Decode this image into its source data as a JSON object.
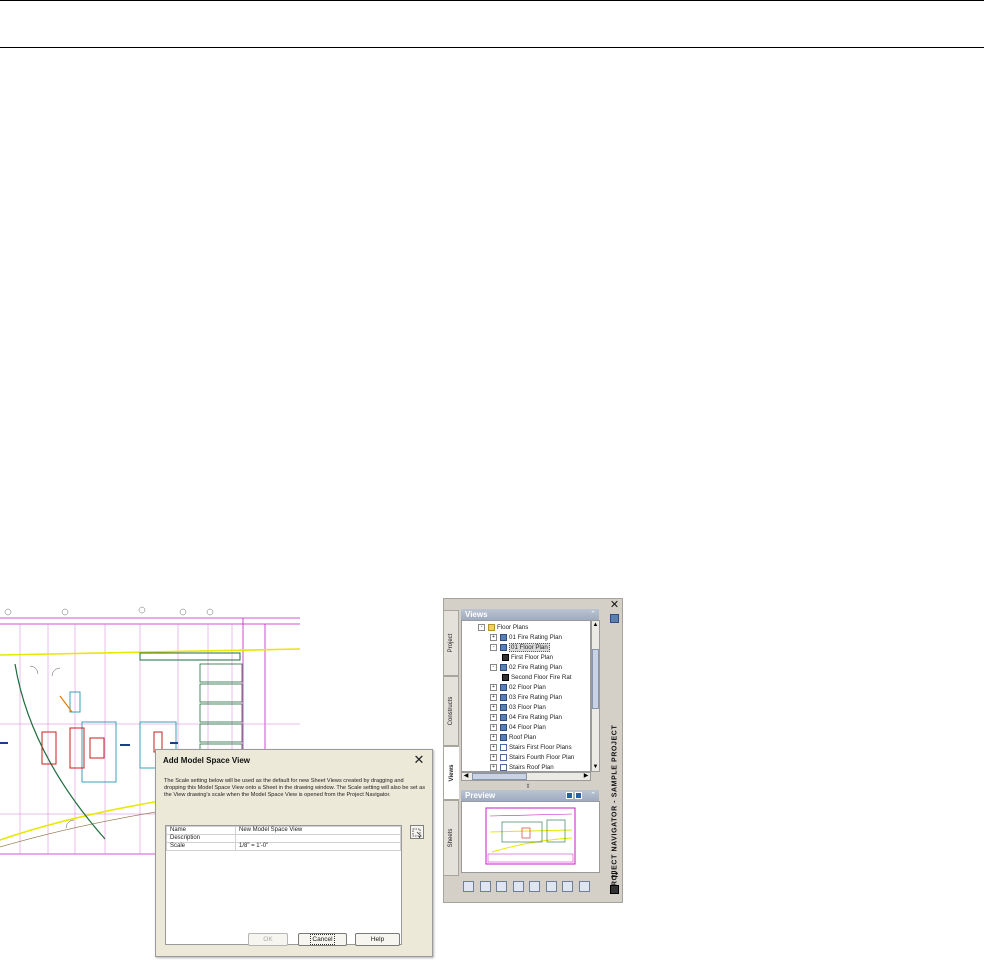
{
  "dialog": {
    "title": "Add Model Space View",
    "description": "The Scale setting below will be used as the default for new Sheet Views created by dragging and dropping this Model Space View onto a Sheet in the drawing window. The Scale setting will also be set as the View drawing's scale when the Model Space View is opened from the Project Navigator.",
    "fields": [
      {
        "label": "Name",
        "value": "New Model Space View"
      },
      {
        "label": "Description",
        "value": ""
      },
      {
        "label": "Scale",
        "value": "1/8\" = 1'-0\""
      }
    ],
    "buttons": {
      "ok": "OK",
      "cancel": "Cancel",
      "help": "Help"
    }
  },
  "navigator": {
    "title": "PROJECT NAVIGATOR - SAMPLE PROJECT",
    "tabs": [
      "Project",
      "Constructs",
      "Views",
      "Sheets"
    ],
    "active_tab": "Views",
    "views_header": "Views",
    "preview_header": "Preview",
    "tree": [
      {
        "label": "Floor Plans",
        "level": 0,
        "icon": "folder-icon",
        "expander": "-"
      },
      {
        "label": "01 Fire Rating Plan",
        "level": 1,
        "icon": "view-icon",
        "expander": "+"
      },
      {
        "label": "01 Floor Plan",
        "level": 1,
        "icon": "view-icon",
        "expander": "-",
        "selected": true
      },
      {
        "label": "First Floor Plan",
        "level": 2,
        "icon": "modelspace-icon",
        "expander": ""
      },
      {
        "label": "02 Fire Rating Plan",
        "level": 1,
        "icon": "view-icon",
        "expander": "-"
      },
      {
        "label": "Second Floor Fire Rat",
        "level": 2,
        "icon": "modelspace-icon",
        "expander": ""
      },
      {
        "label": "02 Floor Plan",
        "level": 1,
        "icon": "view-icon",
        "expander": "+"
      },
      {
        "label": "03 Fire Rating Plan",
        "level": 1,
        "icon": "view-icon",
        "expander": "+"
      },
      {
        "label": "03 Floor Plan",
        "level": 1,
        "icon": "view-icon",
        "expander": "+"
      },
      {
        "label": "04 Fire Rating Plan",
        "level": 1,
        "icon": "view-icon",
        "expander": "+"
      },
      {
        "label": "04 Floor Plan",
        "level": 1,
        "icon": "view-icon",
        "expander": "+"
      },
      {
        "label": "Roof Plan",
        "level": 1,
        "icon": "view-icon",
        "expander": "+"
      },
      {
        "label": "Stairs First Floor Plans",
        "level": 1,
        "icon": "stair-view-icon",
        "expander": "+"
      },
      {
        "label": "Stairs Fourth Floor Plan",
        "level": 1,
        "icon": "stair-view-icon",
        "expander": "+"
      },
      {
        "label": "Stairs Roof Plan",
        "level": 1,
        "icon": "stair-view-icon",
        "expander": "+"
      }
    ],
    "toolbar_icons": [
      "new-category-icon",
      "new-view-icon",
      "new-detail-view-icon",
      "new-section-view-icon",
      "new-elevation-view-icon",
      "schedule-icon",
      "regenerate-icon",
      "repath-icon"
    ]
  },
  "colors": {
    "dialog_bg": "#ece9d8",
    "panel_header": "#9fabbf",
    "cad_magenta": "#c21ec2",
    "cad_yellow": "#e8e800",
    "cad_green": "#1d6d3c"
  }
}
